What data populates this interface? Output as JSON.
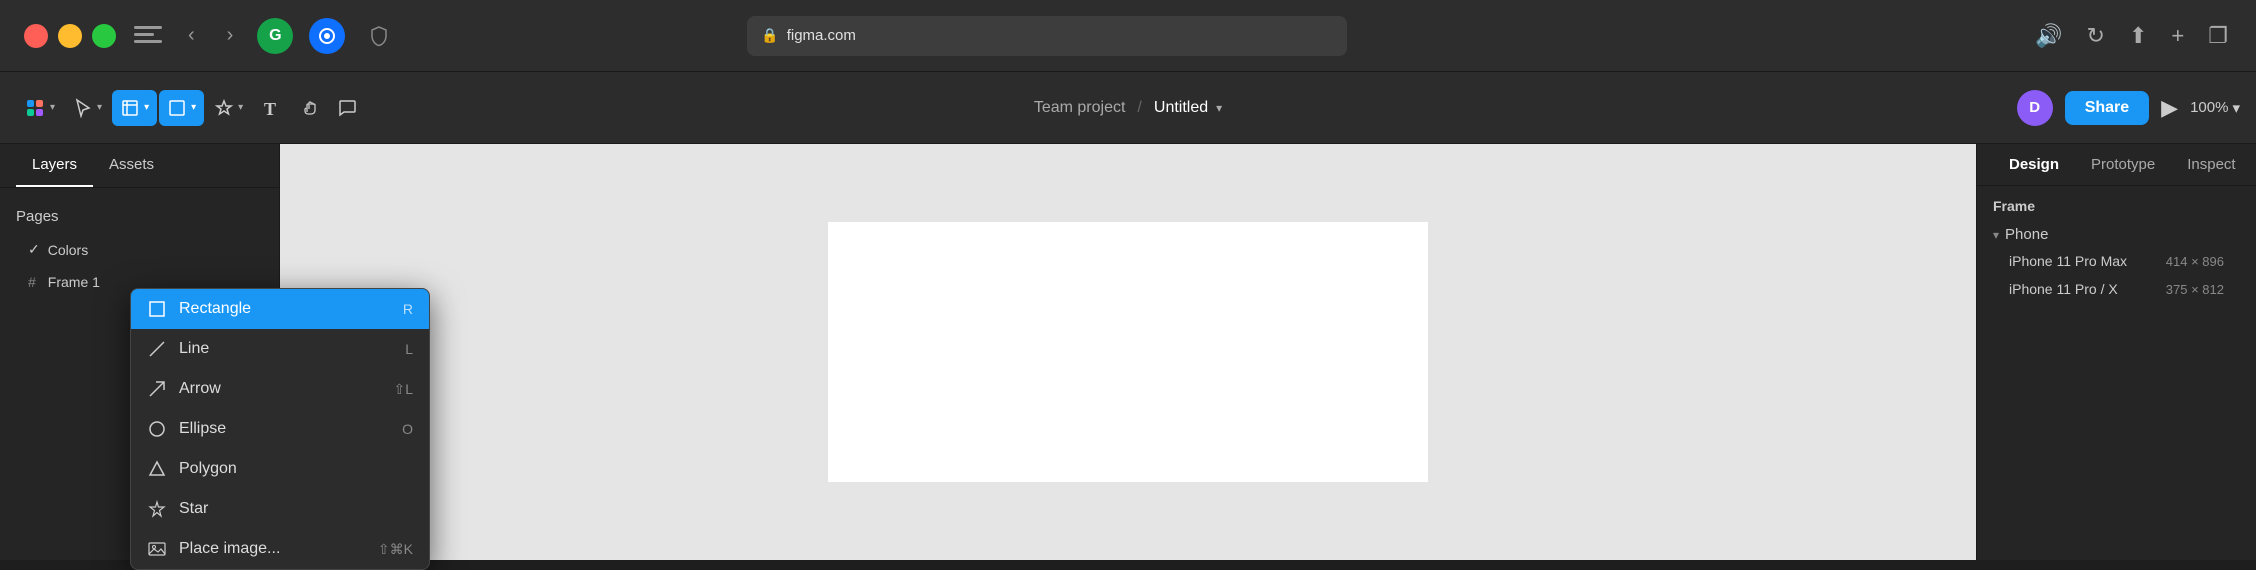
{
  "browser": {
    "url": "figma.com",
    "back_label": "‹",
    "forward_label": "›",
    "grammarly_label": "G",
    "onepassword_label": "●",
    "shield_label": "🛡",
    "lock_icon": "🔒",
    "share_icon": "⬆",
    "add_tab_icon": "+",
    "tabs_icon": "❐",
    "volume_icon": "🔊",
    "refresh_icon": "↻"
  },
  "toolbar": {
    "project_name": "Team project",
    "separator": "/",
    "file_name": "Untitled",
    "dropdown_arrow": "▾",
    "zoom_label": "100%",
    "zoom_arrow": "▾",
    "share_label": "Share",
    "avatar_label": "D",
    "play_icon": "▶"
  },
  "left_panel": {
    "tabs": [
      {
        "label": "Layers",
        "active": true
      },
      {
        "label": "Assets",
        "active": false
      }
    ],
    "pages_label": "Pages",
    "pages": [
      {
        "label": "Colors",
        "active": true,
        "check": "✓"
      },
      {
        "label": "Frame 1",
        "hash": "#"
      }
    ]
  },
  "shape_dropdown": {
    "items": [
      {
        "label": "Rectangle",
        "icon": "rect",
        "shortcut": "R",
        "selected": true
      },
      {
        "label": "Line",
        "icon": "line",
        "shortcut": "L",
        "selected": false
      },
      {
        "label": "Arrow",
        "icon": "arrow",
        "shortcut": "⇧L",
        "selected": false
      },
      {
        "label": "Ellipse",
        "icon": "ellipse",
        "shortcut": "O",
        "selected": false
      },
      {
        "label": "Polygon",
        "icon": "polygon",
        "shortcut": "",
        "selected": false
      },
      {
        "label": "Star",
        "icon": "star",
        "shortcut": "",
        "selected": false
      },
      {
        "label": "Place image...",
        "icon": "image",
        "shortcut": "⇧⌘K",
        "selected": false
      }
    ]
  },
  "right_panel": {
    "tabs": [
      {
        "label": "Design",
        "active": true
      },
      {
        "label": "Prototype",
        "active": false
      },
      {
        "label": "Inspect",
        "active": false
      }
    ],
    "section_label": "Frame",
    "frame_groups": [
      {
        "label": "Phone",
        "expanded": true,
        "items": [
          {
            "name": "iPhone 11 Pro Max",
            "size": "414 × 896"
          },
          {
            "name": "iPhone 11 Pro / X",
            "size": "375 × 812"
          }
        ]
      }
    ]
  }
}
